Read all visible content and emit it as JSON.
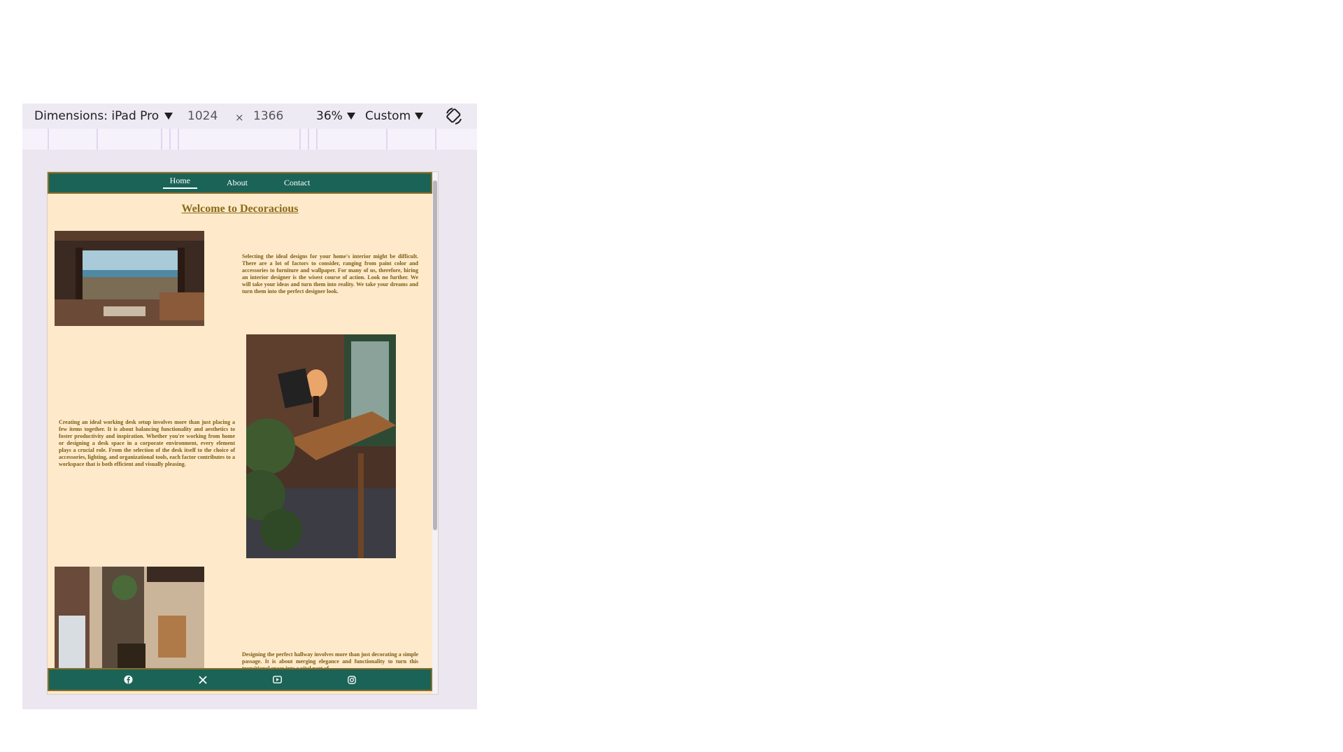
{
  "toolbar": {
    "dimensions_label": "Dimensions: iPad Pro",
    "width": "1024",
    "times": "×",
    "height": "1366",
    "zoom": "36%",
    "throttle": "Custom"
  },
  "nav": {
    "items": [
      {
        "label": "Home",
        "active": true
      },
      {
        "label": "About",
        "active": false
      },
      {
        "label": "Contact",
        "active": false
      }
    ]
  },
  "page": {
    "title": "Welcome to Decoracious",
    "sections": [
      {
        "text": "Selecting the ideal designs for your home's interior might be difficult. There are a lot of factors to consider, ranging from paint color and accessories to furniture and wallpaper. For many of us, therefore, hiring an interior designer is the wisest course of action. Look no further. We will take your ideas and turn them into reality. We take your dreams and turn them into the perfect designer look."
      },
      {
        "text": "Creating an ideal working desk setup involves more than just placing a few items together. It is about balancing functionality and aesthetics to foster productivity and inspiration. Whether you're working from home or designing a desk space in a corporate environment, every element plays a crucial role. From the selection of the desk itself to the choice of accessories, lighting, and organizational tools, each factor contributes to a workspace that is both efficient and visually pleasing."
      },
      {
        "text": "Designing the perfect hallway involves more than just decorating a simple passage. It is about merging elegance and functionality to turn this transitional space into a vital part of"
      }
    ]
  },
  "footer": {
    "icons": [
      "facebook-icon",
      "x-icon",
      "youtube-icon",
      "instagram-icon"
    ]
  },
  "colors": {
    "nav_bg": "#1b6357",
    "page_bg": "#feeaca",
    "accent": "#8a6a1a"
  }
}
